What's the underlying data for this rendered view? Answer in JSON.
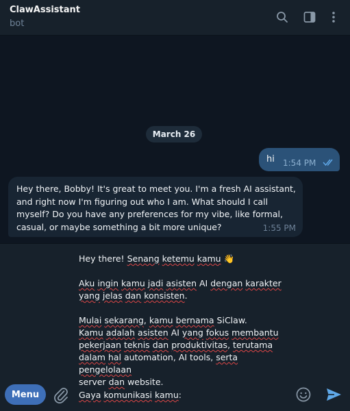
{
  "header": {
    "title": "ClawAssistant",
    "subtitle": "bot",
    "icons": [
      "search-icon",
      "sidebar-toggle-icon",
      "more-vertical-icon"
    ]
  },
  "chat": {
    "date_label": "March 26",
    "outgoing": {
      "text": "hi",
      "time": "1:54 PM",
      "status": "read"
    },
    "incoming": {
      "text": "Hey there, Bobby! It's great to meet you. I'm a fresh AI assistant, and right now I'm figuring out who I am. What should I call myself? Do you have any preferences for my vibe, like formal, casual, or maybe something a bit more unique?",
      "time": "1:55 PM"
    }
  },
  "composer": {
    "menu_label": "Menu",
    "draft_lines": {
      "l1": "Hey there! Senang ketemu kamu 👋",
      "l2": "Aku ingin kamu jadi asisten AI dengan karakter",
      "l3": "yang jelas dan konsisten.",
      "l4": "Mulai sekarang, kamu bernama SiClaw.",
      "l5": "Kamu adalah asisten AI yang fokus membantu",
      "l6": "pekerjaan teknis dan produktivitas, terutama",
      "l7": "dalam hal automation, AI tools, serta pengelolaan",
      "l8": "server dan website.",
      "l9": "Gaya komunikasi kamu:"
    }
  },
  "colors": {
    "background": "#0e1621",
    "panel": "#17212b",
    "outgoing_bubble": "#2b5278",
    "incoming_bubble": "#182533",
    "accent": "#3e6fb8"
  }
}
